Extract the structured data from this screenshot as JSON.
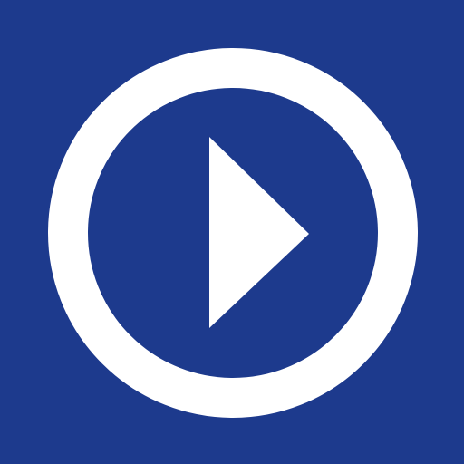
{
  "app_icon": {
    "icon": "play-circle-icon",
    "colors": {
      "background": "#1d3a8d",
      "foreground": "#ffffff"
    }
  }
}
